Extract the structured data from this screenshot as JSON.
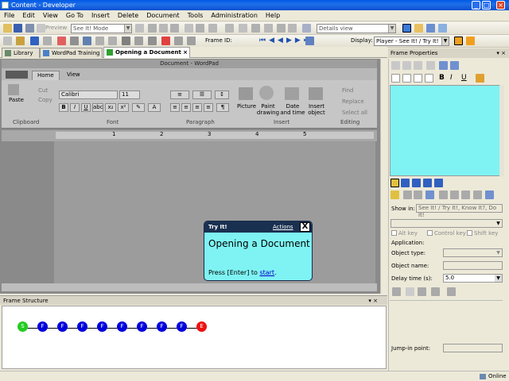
{
  "window": {
    "title": "Content - Developer"
  },
  "menu": [
    "File",
    "Edit",
    "View",
    "Go To",
    "Insert",
    "Delete",
    "Document",
    "Tools",
    "Administration",
    "Help"
  ],
  "toolbar1": {
    "preview_label": "Preview",
    "mode_value": "See It! Mode",
    "view_value": "Details view"
  },
  "toolbar2": {
    "frame_id_label": "Frame ID:",
    "display_label": "Display:",
    "display_value": "Player - See It! / Try It!"
  },
  "tabs": [
    {
      "label": "Library",
      "active": false
    },
    {
      "label": "WordPad Training",
      "active": false
    },
    {
      "label": "Opening a Document",
      "active": true
    }
  ],
  "wordpad": {
    "title": "Document - WordPad",
    "ribbon_tabs": [
      "Home",
      "View"
    ],
    "clipboard": {
      "paste": "Paste",
      "cut": "Cut",
      "copy": "Copy",
      "label": "Clipboard"
    },
    "font": {
      "name": "Calibri",
      "size": "11",
      "label": "Font"
    },
    "paragraph": {
      "label": "Paragraph"
    },
    "insert": {
      "picture": "Picture",
      "paint": "Paint drawing",
      "datetime": "Date and time",
      "object": "Insert object",
      "label": "Insert"
    },
    "editing": {
      "find": "Find",
      "replace": "Replace",
      "select_all": "Select all",
      "label": "Editing"
    },
    "ruler": [
      "1",
      "2",
      "3",
      "4",
      "5"
    ]
  },
  "bubble": {
    "header": "Try It!",
    "actions": "Actions",
    "close": "X",
    "title": "Opening a Document",
    "text_prefix": "Press [Enter] to ",
    "link": "start",
    "text_suffix": "."
  },
  "frame_structure": {
    "title": "Frame Structure",
    "nodes": [
      "S",
      "F",
      "F",
      "F",
      "F",
      "F",
      "F",
      "F",
      "F",
      "E"
    ],
    "colors": {
      "start": "#22cc22",
      "frame": "#0000dd",
      "end": "#ee1111"
    }
  },
  "frame_properties": {
    "title": "Frame Properties",
    "show_in_label": "Show in:",
    "show_in_value": "See It! / Try It!, Know It?, Do It!",
    "alt_key": "Alt key",
    "control_key": "Control key",
    "shift_key": "Shift key",
    "application_label": "Application:",
    "object_type_label": "Object type:",
    "object_name_label": "Object name:",
    "delay_label": "Delay time (s):",
    "delay_value": "5.0",
    "jump_in_label": "Jump-in point:",
    "swatch_color": "#7ff3f3"
  },
  "status": {
    "online": "Online"
  }
}
